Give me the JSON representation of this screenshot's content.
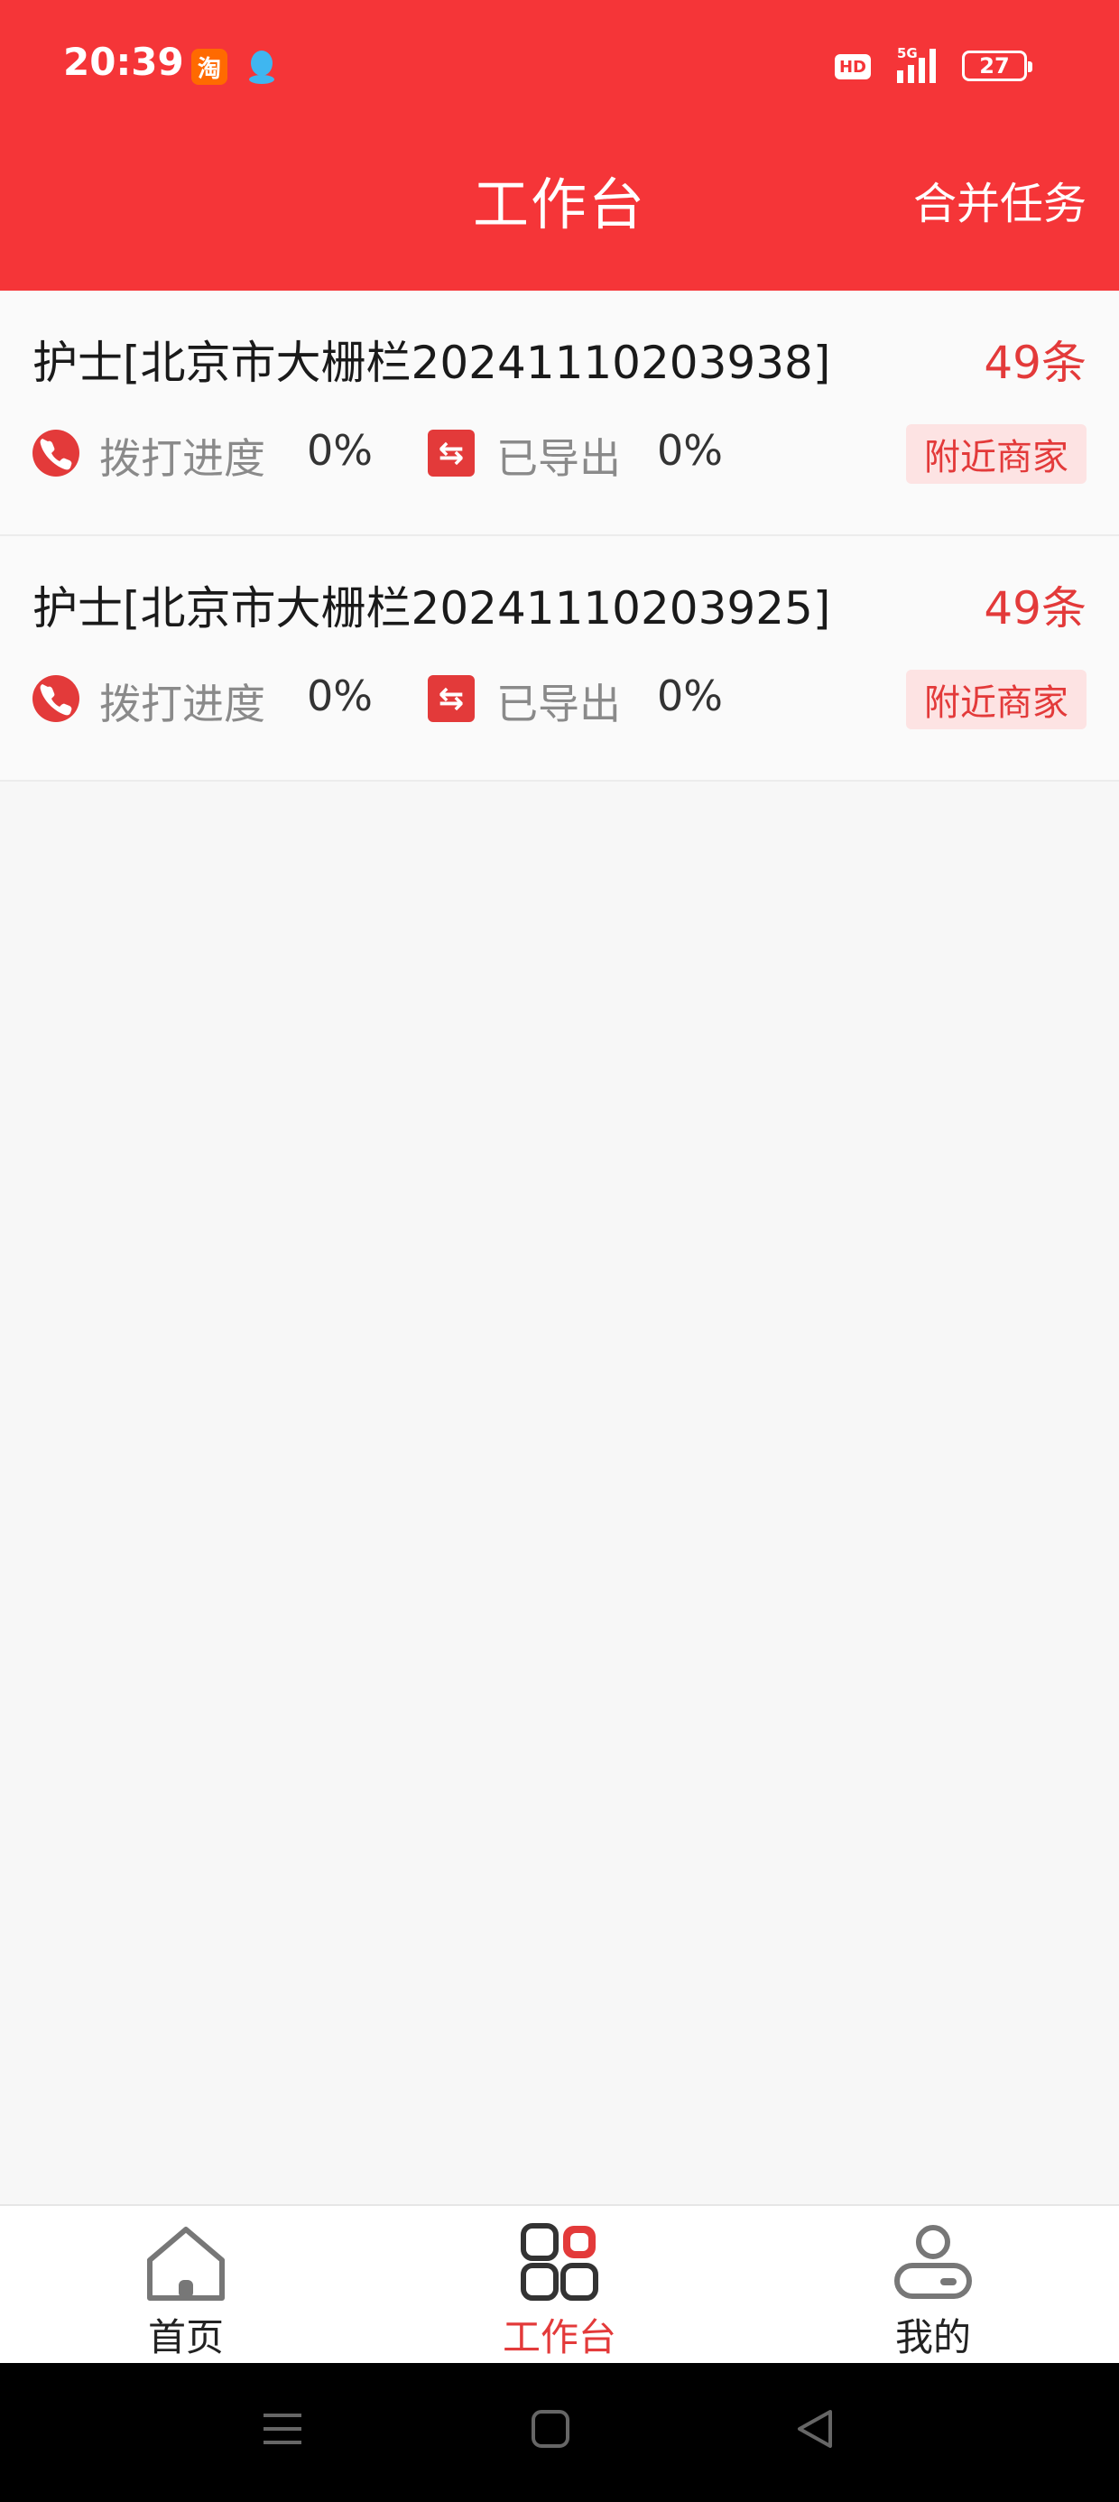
{
  "status_bar": {
    "time": "20:39",
    "hd": "HD",
    "network": "5G",
    "battery": "27"
  },
  "header": {
    "title": "工作台",
    "merge_button": "合并任务"
  },
  "tasks": [
    {
      "title": "护士[北京市大栅栏20241110203938]",
      "count": "49条",
      "dial_label": "拨打进度",
      "dial_value": "0%",
      "export_label": "已导出",
      "export_value": "0%",
      "tag": "附近商家"
    },
    {
      "title": "护士[北京市大栅栏20241110203925]",
      "count": "49条",
      "dial_label": "拨打进度",
      "dial_value": "0%",
      "export_label": "已导出",
      "export_value": "0%",
      "tag": "附近商家"
    }
  ],
  "bottom_nav": [
    {
      "label": "首页"
    },
    {
      "label": "工作台"
    },
    {
      "label": "我的"
    }
  ],
  "colors": {
    "brand_red": "#f53538",
    "accent_red": "#e33a3a",
    "tag_bg": "#fde3e3"
  }
}
